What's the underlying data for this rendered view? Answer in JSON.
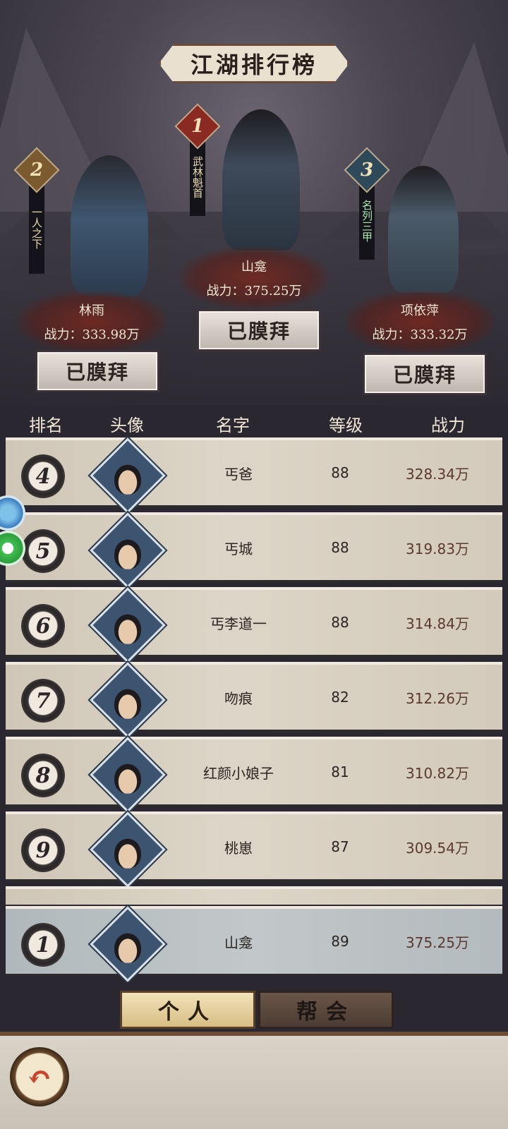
{
  "title": "江湖排行榜",
  "podium": [
    {
      "rank": "2",
      "epithet": "一人之下",
      "name": "林雨",
      "power": "战力：333.98万",
      "button": "已膜拜",
      "color": "#7a5a2e"
    },
    {
      "rank": "1",
      "epithet": "武林魁首",
      "name": "山龛",
      "power": "战力：375.25万",
      "button": "已膜拜",
      "color": "#8a2a22"
    },
    {
      "rank": "3",
      "epithet": "名列三甲",
      "name": "项依萍",
      "power": "战力：333.32万",
      "button": "已膜拜",
      "color": "#2e4a5a"
    }
  ],
  "headers": {
    "rank": "排名",
    "avatar": "头像",
    "name": "名字",
    "level": "等级",
    "power": "战力"
  },
  "rows": [
    {
      "rank": "4",
      "name": "丐爸",
      "level": "88",
      "power": "328.34万"
    },
    {
      "rank": "5",
      "name": "丐城",
      "level": "88",
      "power": "319.83万"
    },
    {
      "rank": "6",
      "name": "丐李道一",
      "level": "88",
      "power": "314.84万"
    },
    {
      "rank": "7",
      "name": "吻痕",
      "level": "82",
      "power": "312.26万"
    },
    {
      "rank": "8",
      "name": "红颜小娘子",
      "level": "81",
      "power": "310.82万"
    },
    {
      "rank": "9",
      "name": "桃崽",
      "level": "87",
      "power": "309.54万"
    }
  ],
  "self_row": {
    "rank": "1",
    "name": "山龛",
    "level": "89",
    "power": "375.25万"
  },
  "tabs": {
    "personal": "个人",
    "guild": "帮会"
  },
  "back_glyph": "↶"
}
